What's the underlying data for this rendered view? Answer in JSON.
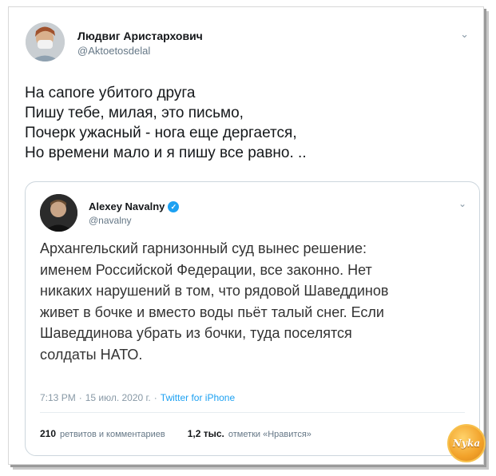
{
  "tweet": {
    "author_name": "Людвиг Аристархович",
    "author_handle": "@Aktoetosdelal",
    "menu_icon": "chevron-down-icon",
    "text_lines": [
      "На сапоге убитого друга",
      "Пишу тебе, милая, это письмо,",
      "Почерк ужасный - нога еще дергается,",
      "Но времени мало и я пишу все равно. .."
    ]
  },
  "quoted": {
    "author_name": "Alexey Navalny",
    "verified_icon": "verified-badge-icon",
    "author_handle": "@navalny",
    "menu_icon": "chevron-down-icon",
    "text_lines": [
      "Архангельский гарнизонный суд вынес решение:",
      "именем Российской Федерации, все законно. Нет",
      "никаких нарушений в том, что рядовой Шаведдинов",
      "живет в бочке и вместо воды пьёт талый снег. Если",
      "Шаведдинова убрать из бочки, туда поселятся",
      "солдаты НАТО."
    ],
    "time": "7:13 PM",
    "separator1": "·",
    "date": "15 июл. 2020 г.",
    "separator2": "·",
    "source": "Twitter for iPhone",
    "retweets_count": "210",
    "retweets_label": "ретвитов и комментариев",
    "likes_count": "1,2 тыс.",
    "likes_label": "отметки «Нравится»"
  },
  "watermark": {
    "text": "Nуka",
    "colors": {
      "fill": "#f2a22a",
      "border": "#f7c14d"
    }
  },
  "colors": {
    "link": "#1da1f2",
    "secondary": "#657786",
    "border": "#ccd6dd"
  }
}
